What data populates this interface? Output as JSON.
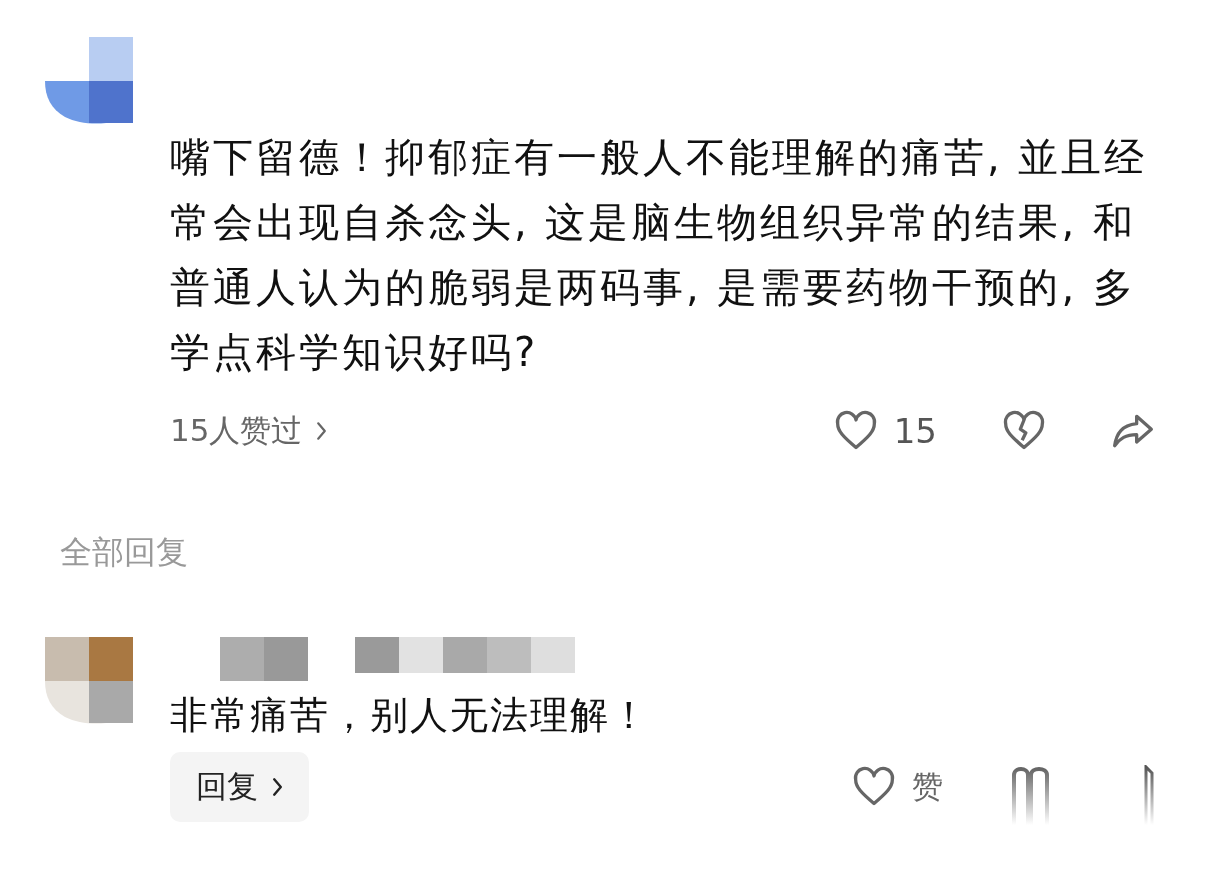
{
  "comment": {
    "text": "嘴下留德！抑郁症有一般人不能理解的痛苦, 並且经常会出现自杀念头, 这是脑生物组织异常的结果, 和普通人认为的脆弱是两码事, 是需要药物干预的, 多学点科学知识好吗?",
    "likers": "15人赞过",
    "likes": "15",
    "liked": false
  },
  "replies_heading": "全部回复",
  "replies": [
    {
      "text": "非常痛苦，别人无法理解！",
      "reply_button": "回复",
      "like_label": "赞",
      "liked": false
    }
  ]
}
